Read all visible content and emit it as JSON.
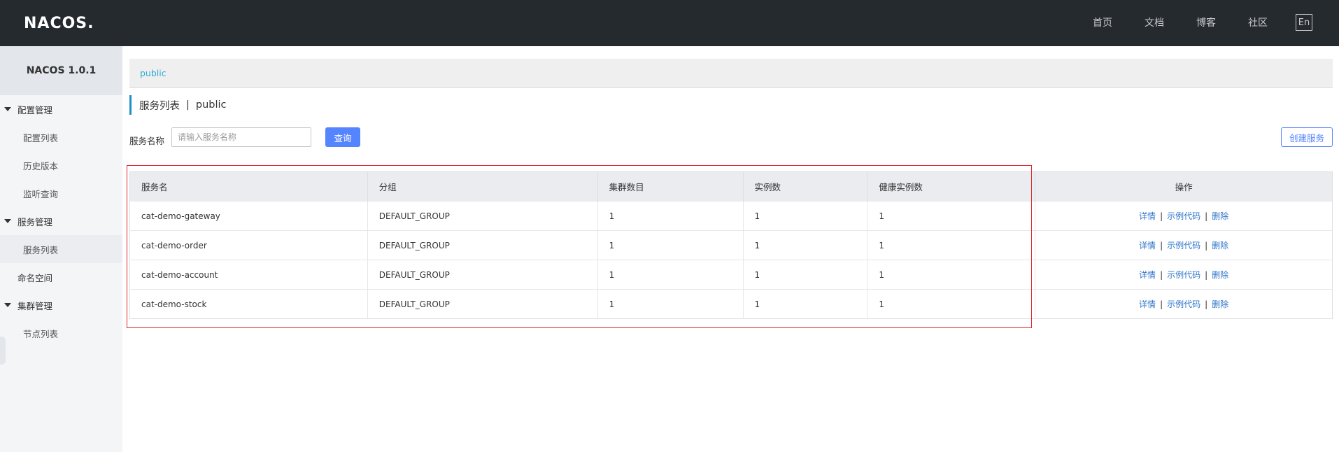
{
  "header": {
    "logo": "NACOS.",
    "nav": [
      "首页",
      "文档",
      "博客",
      "社区"
    ],
    "lang": "En"
  },
  "sidebar": {
    "version": "NACOS 1.0.1",
    "groups": [
      {
        "label": "配置管理",
        "items": [
          "配置列表",
          "历史版本",
          "监听查询"
        ]
      },
      {
        "label": "服务管理",
        "items": [
          "服务列表"
        ]
      }
    ],
    "namespace_item": "命名空间",
    "cluster_group": {
      "label": "集群管理",
      "items": [
        "节点列表"
      ]
    },
    "active_item": "服务列表"
  },
  "main": {
    "namespace": "public",
    "heading": {
      "title": "服务列表",
      "separator": "|",
      "namespace": "public"
    },
    "search": {
      "label": "服务名称",
      "placeholder": "请输入服务名称",
      "value": "",
      "query_label": "查询",
      "create_label": "创建服务"
    },
    "table": {
      "columns": [
        "服务名",
        "分组",
        "集群数目",
        "实例数",
        "健康实例数",
        "操作"
      ],
      "rows": [
        {
          "name": "cat-demo-gateway",
          "group": "DEFAULT_GROUP",
          "clusters": "1",
          "instances": "1",
          "healthy": "1"
        },
        {
          "name": "cat-demo-order",
          "group": "DEFAULT_GROUP",
          "clusters": "1",
          "instances": "1",
          "healthy": "1"
        },
        {
          "name": "cat-demo-account",
          "group": "DEFAULT_GROUP",
          "clusters": "1",
          "instances": "1",
          "healthy": "1"
        },
        {
          "name": "cat-demo-stock",
          "group": "DEFAULT_GROUP",
          "clusters": "1",
          "instances": "1",
          "healthy": "1"
        }
      ],
      "actions": [
        "详情",
        "示例代码",
        "删除"
      ],
      "action_separator": "|"
    }
  },
  "colors": {
    "header_bg": "#252a2f",
    "primary": "#5584ff",
    "link": "#2e75c9",
    "highlight": "#e0252c"
  }
}
